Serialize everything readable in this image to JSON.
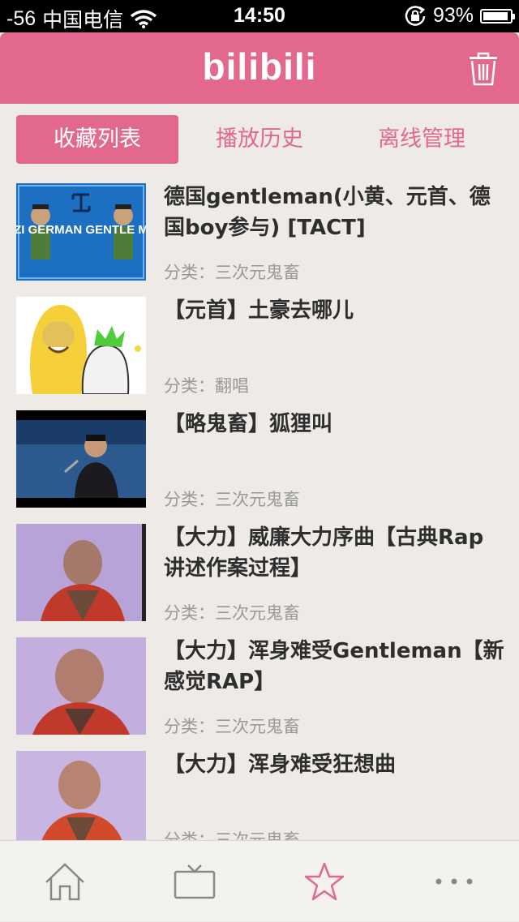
{
  "status_bar": {
    "signal": "-56",
    "carrier": "中国电信",
    "time": "14:50",
    "battery_percent": "93%",
    "battery_level": 0.93
  },
  "navbar": {
    "logo": "bilibili",
    "icons": [
      "trash-icon"
    ]
  },
  "tabs": [
    {
      "label": "收藏列表",
      "active": true
    },
    {
      "label": "播放历史",
      "active": false
    },
    {
      "label": "离线管理",
      "active": false
    }
  ],
  "videos": [
    {
      "title": "德国gentleman(小黄、元首、德国boy参与) [TACT]",
      "category": "分类：三次元鬼畜",
      "thumbnail_text": "NAZI GERMAN GENTLE MAN"
    },
    {
      "title": "【元首】土豪去哪儿",
      "category": "分类：翻唱"
    },
    {
      "title": "【略鬼畜】狐狸叫",
      "category": "分类：三次元鬼畜"
    },
    {
      "title": "【大力】威廉大力序曲【古典Rap讲述作案过程】",
      "category": "分类：三次元鬼畜"
    },
    {
      "title": "【大力】浑身难受Gentleman【新感觉RAP】",
      "category": "分类：三次元鬼畜"
    },
    {
      "title": "【大力】浑身难受狂想曲",
      "category": "分类：三次元鬼畜"
    }
  ],
  "tabbar": {
    "items": [
      "home-icon",
      "tv-icon",
      "star-icon",
      "more-icon"
    ],
    "active_index": 2,
    "accent": "#e2698d"
  },
  "colors": {
    "brand_pink": "#e2698d",
    "background": "#eeebe6",
    "title_text": "#2e2e2e",
    "category_text": "#999999"
  }
}
